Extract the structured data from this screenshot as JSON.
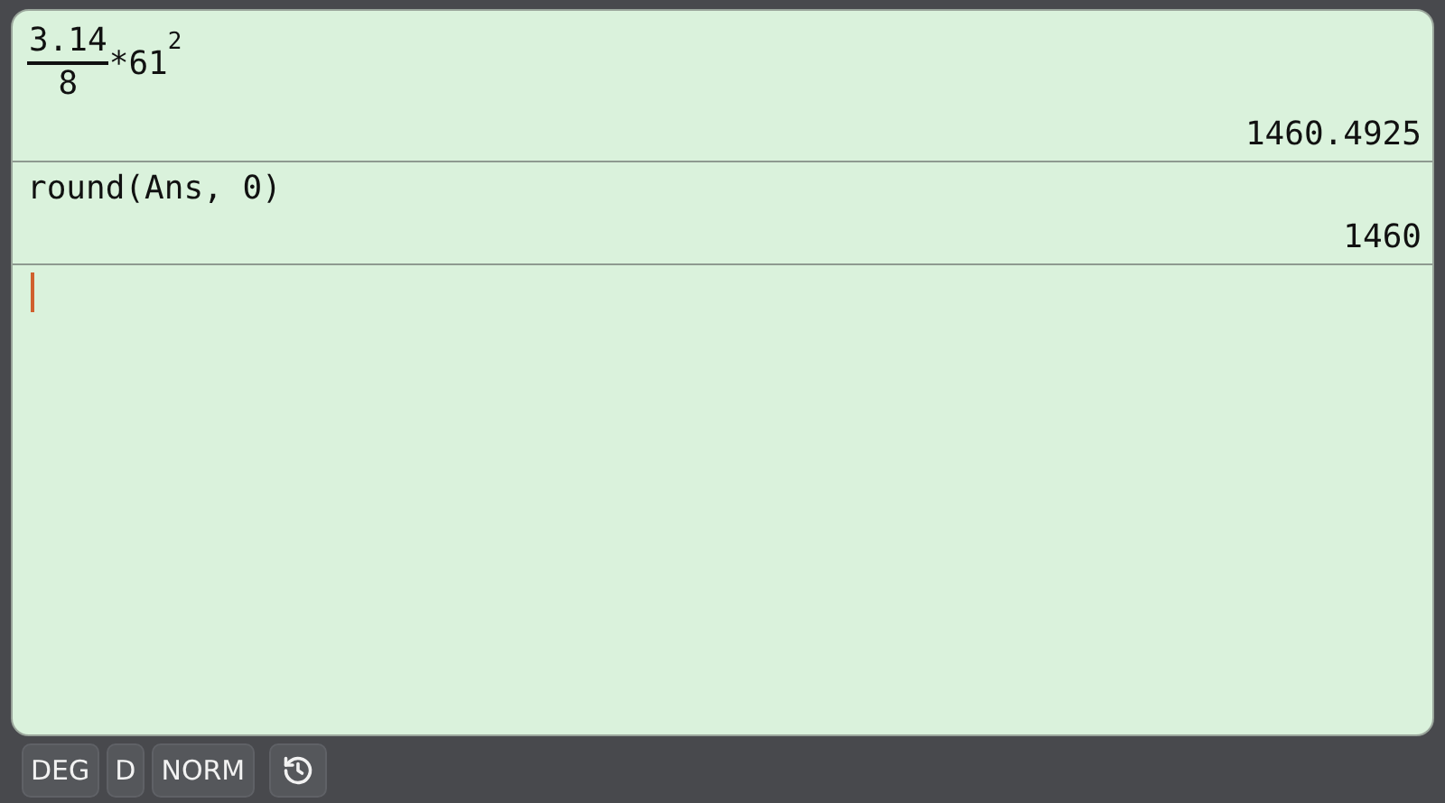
{
  "entries": [
    {
      "kind": "fraction",
      "numerator": "3.14",
      "denominator": "8",
      "rest": "*61",
      "exponent": "2",
      "result": "1460.4925"
    },
    {
      "kind": "plain",
      "expression": "round(Ans, 0)",
      "result": "1460"
    }
  ],
  "status_bar": {
    "buttons": [
      "DEG",
      "D",
      "NORM"
    ]
  }
}
